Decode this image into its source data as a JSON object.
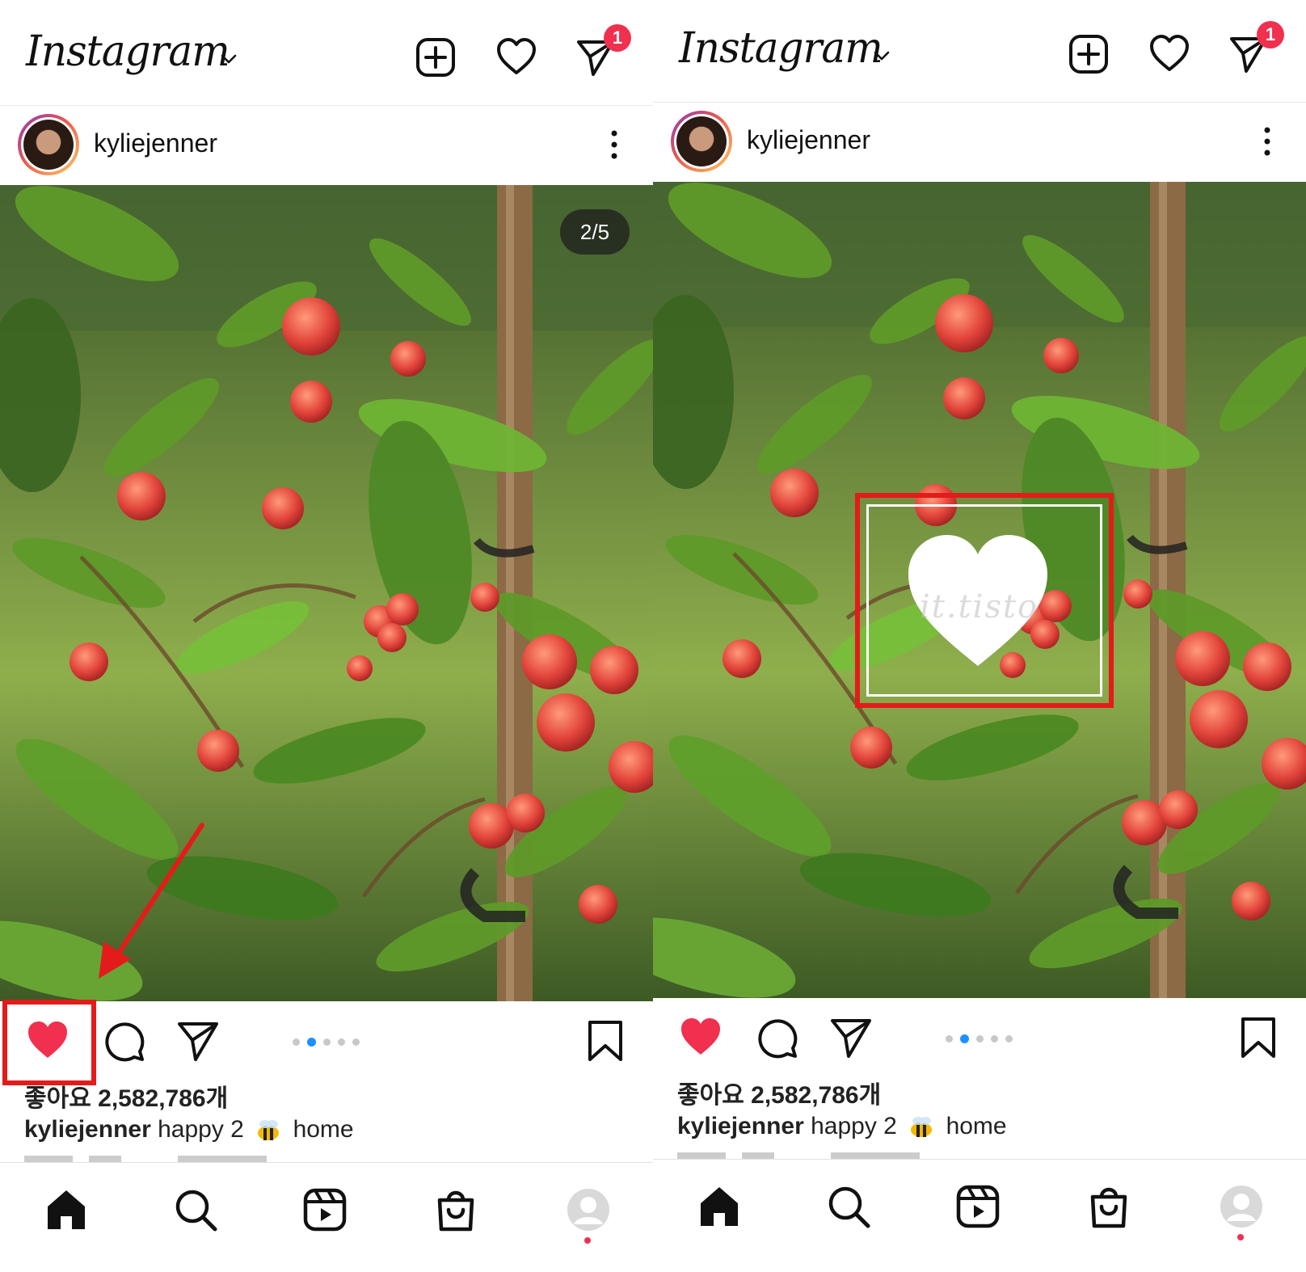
{
  "screens": [
    {
      "id": "left",
      "header": {
        "logo": "Instagram",
        "dm_badge": "1"
      },
      "post": {
        "username": "kyliejenner",
        "counter": "2/5",
        "likes": "좋아요 2,582,786개",
        "caption_user": "kyliejenner",
        "caption_text_before": "happy 2",
        "caption_text_after": "home",
        "liked": true,
        "carousel": {
          "index": 2,
          "total": 5
        }
      },
      "annotation": "like-button-highlighted-with-arrow"
    },
    {
      "id": "right",
      "header": {
        "logo": "Instagram",
        "dm_badge": "1"
      },
      "post": {
        "username": "kyliejenner",
        "likes": "좋아요 2,582,786개",
        "caption_user": "kyliejenner",
        "caption_text_before": "happy 2",
        "caption_text_after": "home",
        "liked": true,
        "carousel": {
          "index": 2,
          "total": 5
        }
      },
      "annotation": "double-tap-heart-highlighted",
      "watermark": "it.tisto"
    }
  ],
  "icons": {
    "header": [
      "add-post-icon",
      "heart-icon",
      "direct-message-icon"
    ],
    "post_actions": [
      "like-heart-icon",
      "comment-icon",
      "share-icon",
      "bookmark-icon"
    ],
    "bottom_nav": [
      "home-icon",
      "search-icon",
      "reels-icon",
      "shop-icon",
      "profile-icon"
    ]
  },
  "colors": {
    "like_red": "#f0304e",
    "highlight_red": "#e31b1b",
    "carousel_active": "#1e90ff",
    "badge": "#f0304e"
  }
}
